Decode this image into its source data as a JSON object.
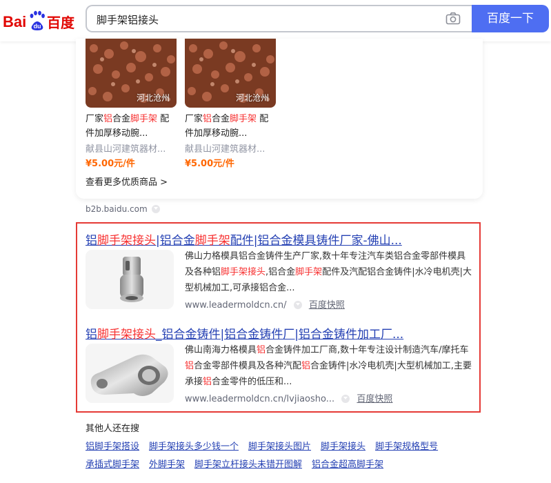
{
  "header": {
    "logo_text": "Baidu百度",
    "search_query": "脚手架铝接头",
    "search_button": "百度一下",
    "camera_icon": "camera-icon"
  },
  "products": {
    "items": [
      {
        "location": "河北沧州",
        "title_pre": "厂家",
        "title_hl1": "铝",
        "title_mid": "合金",
        "title_hl2": "脚手架",
        "title_post": " 配件加厚移动腕...",
        "seller": "献县山河建筑器材...",
        "price": "¥5.00元/件"
      },
      {
        "location": "河北沧州",
        "title_pre": "厂家",
        "title_hl1": "铝",
        "title_mid": "合金",
        "title_hl2": "脚手架",
        "title_post": " 配件加厚移动腕...",
        "seller": "献县山河建筑器材...",
        "price": "¥5.00元/件"
      }
    ],
    "more_link": "查看更多优质商品 >"
  },
  "source": "b2b.baidu.com",
  "results": [
    {
      "title_parts": [
        {
          "text": "铝",
          "hl": false
        },
        {
          "text": "脚手架接头",
          "hl": true
        },
        {
          "text": "|铝合金",
          "hl": false
        },
        {
          "text": "脚手架",
          "hl": true
        },
        {
          "text": "配件|铝合金模具铸件厂家-佛山...",
          "hl": false
        }
      ],
      "desc_parts": [
        {
          "text": "佛山力格模具铝合金铸件生产厂家,数十年专注汽车类铝合金零部件模具及各种铝",
          "hl": false
        },
        {
          "text": "脚手架接头",
          "hl": true
        },
        {
          "text": ",铝合金",
          "hl": false
        },
        {
          "text": "脚手架",
          "hl": true
        },
        {
          "text": "配件及汽配铝合金铸件|水冷电机壳|大型机械加工,可承接铝合金...",
          "hl": false
        }
      ],
      "url": "www.leadermoldcn.cn/",
      "snapshot": "百度快照"
    },
    {
      "title_parts": [
        {
          "text": "铝",
          "hl": false
        },
        {
          "text": "脚手架接头",
          "hl": true
        },
        {
          "text": "_铝合金铸件|铝合金铸件厂|铝合金铸件加工厂...",
          "hl": false
        }
      ],
      "desc_parts": [
        {
          "text": "佛山南海力格模具",
          "hl": false
        },
        {
          "text": "铝",
          "hl": true
        },
        {
          "text": "合金铸件加工厂商,数十年专注设计制造汽车/摩托车",
          "hl": false
        },
        {
          "text": "铝",
          "hl": true
        },
        {
          "text": "合金零部件模具及各种汽配",
          "hl": false
        },
        {
          "text": "铝",
          "hl": true
        },
        {
          "text": "合金铸件|水冷电机壳|大型机械加工,主要承接",
          "hl": false
        },
        {
          "text": "铝",
          "hl": true
        },
        {
          "text": "合金零件的低压和...",
          "hl": false
        }
      ],
      "url": "www.leadermoldcn.cn/lvjiaosho...",
      "snapshot": "百度快照"
    }
  ],
  "related": {
    "title": "其他人还在搜",
    "row1": [
      "铝脚手架搭设",
      "脚手架接头多少钱一个",
      "脚手架接头图片",
      "脚手架接头",
      "脚手架规格型号"
    ],
    "row2": [
      "承插式脚手架",
      "外脚手架",
      "脚手架立杆接头未错开图解",
      "铝合金超高脚手架"
    ]
  }
}
